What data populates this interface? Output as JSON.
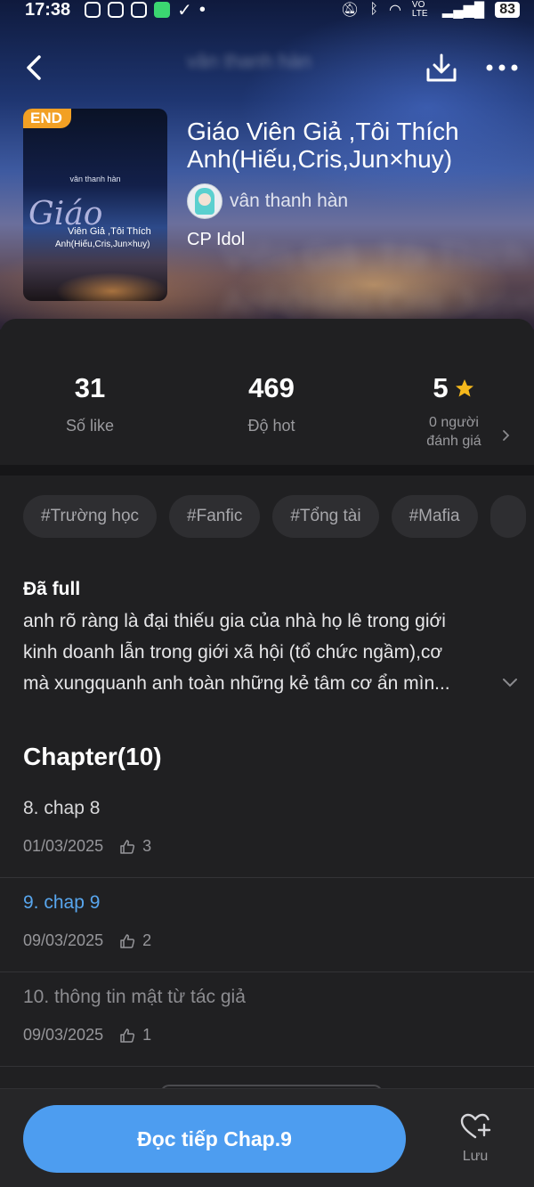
{
  "status_bar": {
    "time": "17:38",
    "battery": "83",
    "network": "VO LTE"
  },
  "header": {
    "blurred_author": "vân thanh hàn",
    "blurred_title_1": "Viên Giả ,Tôi Thích",
    "blurred_title_2": "Anh(Hiếu,Cris,Jun×huy)"
  },
  "book": {
    "badge": "END",
    "cover_author": "vân thanh hàn",
    "cover_script": "Giáo",
    "cover_line1": "Viên Giả ,Tôi Thích",
    "cover_line2": "Anh(Hiếu,Cris,Jun×huy)",
    "title": "Giáo Viên Giả ,Tôi Thích Anh(Hiếu,Cris,Jun×huy)",
    "author": "vân thanh hàn",
    "category": "CP Idol"
  },
  "stats": {
    "likes_value": "31",
    "likes_label": "Số like",
    "hot_value": "469",
    "hot_label": "Độ hot",
    "rating_value": "5",
    "rating_label_1": "0 người",
    "rating_label_2": "đánh giá"
  },
  "tags": [
    "#Trường học",
    "#Fanfic",
    "#Tổng tài",
    "#Mafia"
  ],
  "description": {
    "status": "Đã full",
    "line1": "anh rõ ràng là đại thiếu gia của nhà họ lê trong giới",
    "line2": "kinh doanh lẫn trong giới xã hội (tổ chức ngầm),cơ",
    "line3": "mà xungquanh anh toàn những kẻ tâm cơ ẩn mìn..."
  },
  "chapters": {
    "heading": "Chapter(10)",
    "items": [
      {
        "title": "8. chap 8",
        "date": "01/03/2025",
        "likes": "3"
      },
      {
        "title": "9. chap 9",
        "date": "09/03/2025",
        "likes": "2"
      },
      {
        "title": "10. thông tin mật từ tác giả",
        "date": "09/03/2025",
        "likes": "1"
      }
    ]
  },
  "bottom": {
    "read_button": "Đọc tiếp Chap.9",
    "save_label": "Lưu"
  },
  "colors": {
    "accent": "#4d9df0",
    "active_chapter": "#58a6ee",
    "badge": "#f2a024",
    "star": "#f5b81c"
  }
}
